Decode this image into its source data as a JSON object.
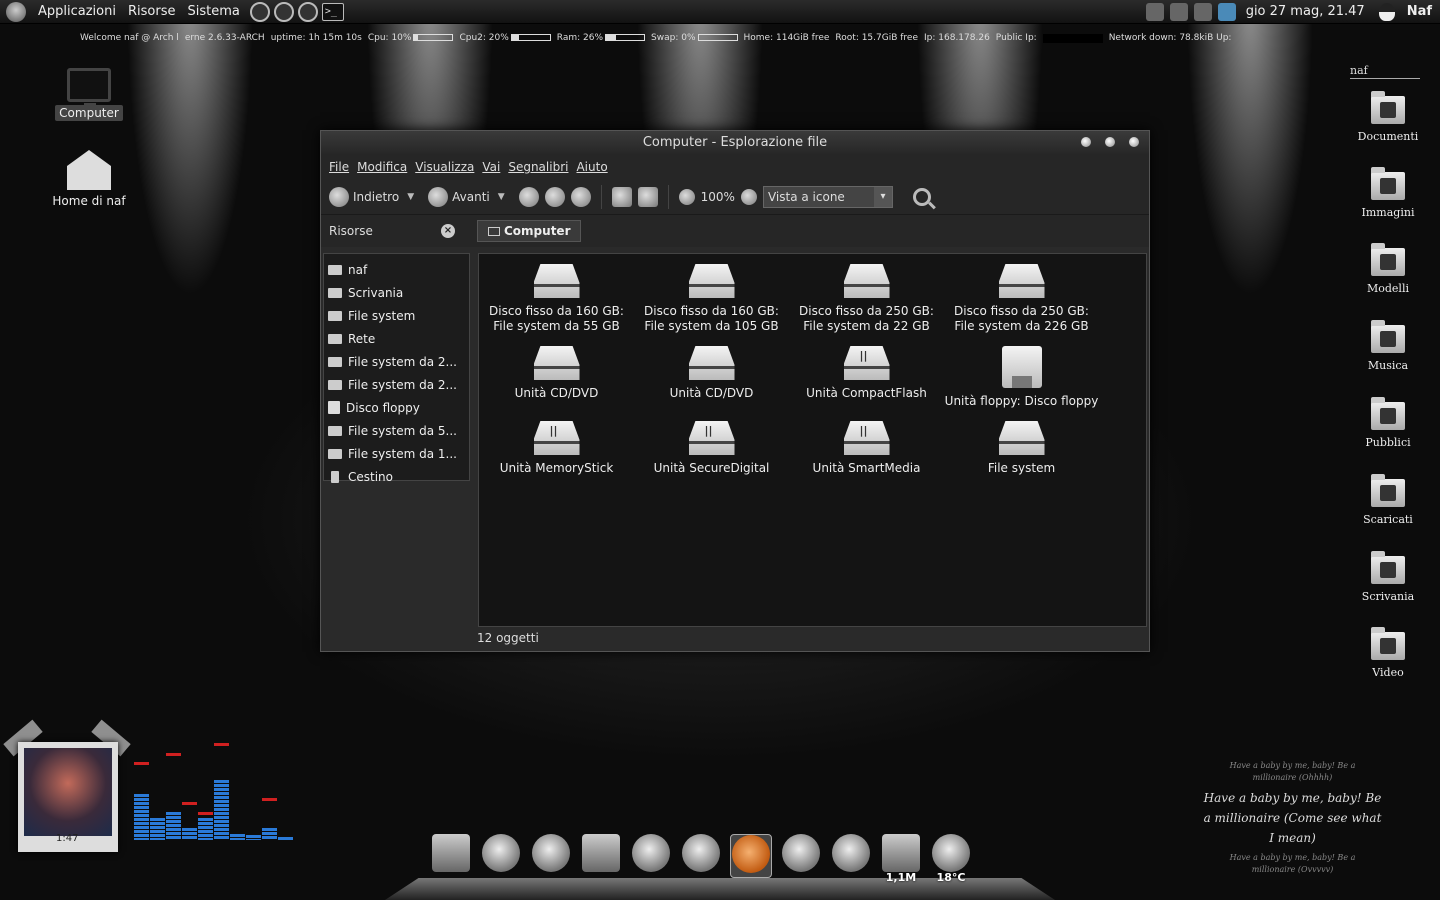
{
  "top_panel": {
    "menus": [
      "Applicazioni",
      "Risorse",
      "Sistema"
    ],
    "clock": "gio 27 mag, 21.47",
    "user": "Naf"
  },
  "conky": {
    "welcome": "Welcome naf @ Arch l",
    "kernel": "erne 2.6.33-ARCH",
    "uptime": "uptime: 1h 15m 10s",
    "cpu1": "Cpu: 10%",
    "cpu1_pct": 10,
    "cpu2": "Cpu2: 20%",
    "cpu2_pct": 20,
    "ram": "Ram: 26%",
    "ram_pct": 26,
    "swap": "Swap: 0%",
    "swap_pct": 0,
    "home": "Home: 114GiB free",
    "root": "Root: 15.7GiB free",
    "ip": "Ip: 168.178.26",
    "public_ip": "Public Ip:",
    "network": "Network down: 78.8kiB  Up:"
  },
  "desktop_left": [
    {
      "label": "Computer",
      "icon": "computer-icon"
    },
    {
      "label": "Home di naf",
      "icon": "home-folder-icon"
    }
  ],
  "desktop_right": {
    "header": "naf",
    "folders": [
      "Documenti",
      "Immagini",
      "Modelli",
      "Musica",
      "Pubblici",
      "Scaricati",
      "Scrivania",
      "Video"
    ]
  },
  "window": {
    "title": "Computer - Esplorazione file",
    "menus": [
      "File",
      "Modifica",
      "Visualizza",
      "Vai",
      "Segnalibri",
      "Aiuto"
    ],
    "toolbar": {
      "back": "Indietro",
      "forward": "Avanti",
      "zoom": "100%",
      "view": "Vista a icone"
    },
    "sidebar_title": "Risorse",
    "location": "Computer",
    "sidebar_items": [
      "naf",
      "Scrivania",
      "File system",
      "Rete",
      "File system da 2...",
      "File system da 2...",
      "Disco floppy",
      "File system da 5...",
      "File system da 1...",
      "Cestino"
    ],
    "files": [
      {
        "label": "Disco fisso da 160 GB: File system da 55 GB",
        "kind": "drive"
      },
      {
        "label": "Disco fisso da 160 GB: File system da 105 GB",
        "kind": "drive"
      },
      {
        "label": "Disco fisso da 250 GB: File system da 22 GB",
        "kind": "drive"
      },
      {
        "label": "Disco fisso da 250 GB: File system da 226 GB",
        "kind": "drive"
      },
      {
        "label": "Unità CD/DVD",
        "kind": "drive"
      },
      {
        "label": "Unità CD/DVD",
        "kind": "drive"
      },
      {
        "label": "Unità CompactFlash",
        "kind": "card"
      },
      {
        "label": "Unità floppy: Disco floppy",
        "kind": "floppy"
      },
      {
        "label": "Unità MemoryStick",
        "kind": "card"
      },
      {
        "label": "Unità SecureDigital",
        "kind": "card"
      },
      {
        "label": "Unità SmartMedia",
        "kind": "card"
      },
      {
        "label": "File system",
        "kind": "drive"
      }
    ],
    "status": "12 oggetti"
  },
  "album": {
    "time": "1:47"
  },
  "lyrics": {
    "top_small": [
      "Have a baby by me, baby! Be a",
      "millionaire (Ohhhh)"
    ],
    "main": "Have a baby by me, baby! Be a millionaire (Come see what I mean)",
    "bottom_small": [
      "Have a baby by me, baby! Be a",
      "millionaire (Ovvvvv)"
    ]
  },
  "dock": {
    "badge_mem": "1,1M",
    "badge_temp": "18°C"
  }
}
